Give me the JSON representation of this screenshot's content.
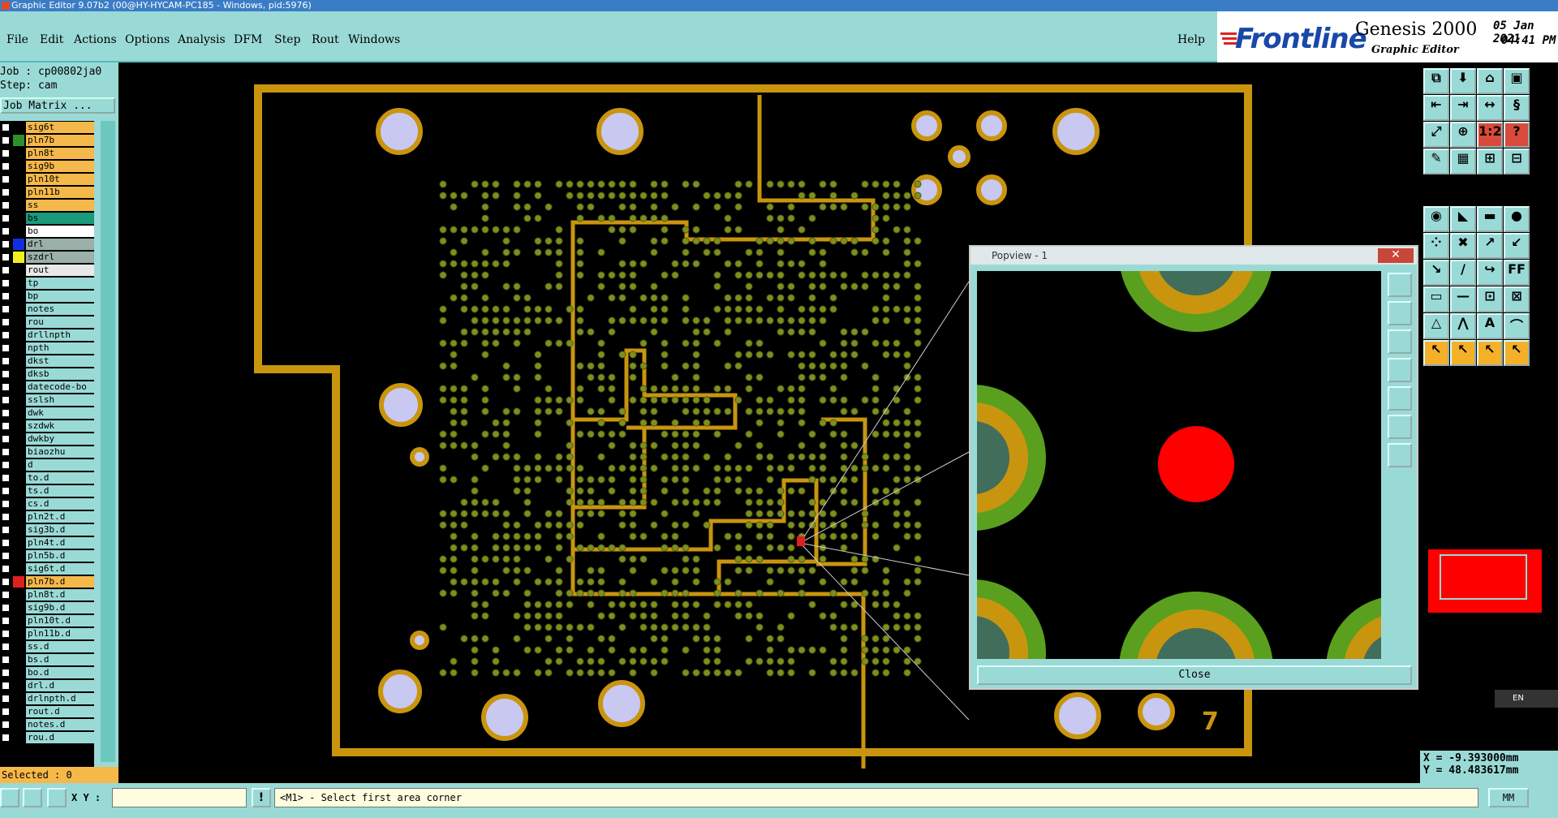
{
  "window": {
    "title": "Graphic Editor 9.07b2 (00@HY-HYCAM-PC185 - Windows, pid:5976)"
  },
  "menubar": {
    "items": [
      {
        "label": "File"
      },
      {
        "label": "Edit"
      },
      {
        "label": "Actions"
      },
      {
        "label": "Options"
      },
      {
        "label": "Analysis"
      },
      {
        "label": "DFM"
      },
      {
        "label": "Step"
      },
      {
        "label": "Rout"
      },
      {
        "label": "Windows"
      }
    ],
    "help": "Help"
  },
  "branding": {
    "logo": "Frontline",
    "product": "Genesis 2000",
    "subtitle": "Graphic Editor",
    "date": "05 Jan 2021",
    "time": "04:41 PM"
  },
  "job": {
    "job_label": "Job : cp00802ja0",
    "step_label": "Step: cam",
    "job_matrix": "Job Matrix ..."
  },
  "layers": [
    {
      "name": "sig6t",
      "color": "#f5b84a",
      "swatch": "#000"
    },
    {
      "name": "pln7b",
      "color": "#f5b84a",
      "swatch": "#2f8f2f"
    },
    {
      "name": "pln8t",
      "color": "#f5b84a",
      "swatch": "#000"
    },
    {
      "name": "sig9b",
      "color": "#f5b84a",
      "swatch": "#000"
    },
    {
      "name": "pln10t",
      "color": "#f5b84a",
      "swatch": "#000"
    },
    {
      "name": "pln11b",
      "color": "#f5b84a",
      "swatch": "#000"
    },
    {
      "name": "ss",
      "color": "#f5b84a",
      "swatch": "#000"
    },
    {
      "name": "bs",
      "color": "#1a9a7a",
      "swatch": "#000"
    },
    {
      "name": "bo",
      "color": "#ffffff",
      "swatch": "#000"
    },
    {
      "name": "drl",
      "color": "#9ab0a8",
      "swatch": "#1030e0"
    },
    {
      "name": "szdrl",
      "color": "#9ab0a8",
      "swatch": "#f0f020"
    },
    {
      "name": "rout",
      "color": "#e8e8e8",
      "swatch": "#000"
    },
    {
      "name": "tp",
      "color": "#9adad6",
      "swatch": "#000"
    },
    {
      "name": "bp",
      "color": "#9adad6",
      "swatch": "#000"
    },
    {
      "name": "notes",
      "color": "#9adad6",
      "swatch": "#000"
    },
    {
      "name": "rou",
      "color": "#9adad6",
      "swatch": "#000"
    },
    {
      "name": "drllnpth",
      "color": "#9adad6",
      "swatch": "#000"
    },
    {
      "name": "npth",
      "color": "#9adad6",
      "swatch": "#000"
    },
    {
      "name": "dkst",
      "color": "#9adad6",
      "swatch": "#000"
    },
    {
      "name": "dksb",
      "color": "#9adad6",
      "swatch": "#000"
    },
    {
      "name": "datecode-bo",
      "color": "#9adad6",
      "swatch": "#000"
    },
    {
      "name": "sslsh",
      "color": "#9adad6",
      "swatch": "#000"
    },
    {
      "name": "dwk",
      "color": "#9adad6",
      "swatch": "#000"
    },
    {
      "name": "szdwk",
      "color": "#9adad6",
      "swatch": "#000"
    },
    {
      "name": "dwkby",
      "color": "#9adad6",
      "swatch": "#000"
    },
    {
      "name": "biaozhu",
      "color": "#9adad6",
      "swatch": "#000"
    },
    {
      "name": "d",
      "color": "#9adad6",
      "swatch": "#000"
    },
    {
      "name": "to.d",
      "color": "#9adad6",
      "swatch": "#000"
    },
    {
      "name": "ts.d",
      "color": "#9adad6",
      "swatch": "#000"
    },
    {
      "name": "cs.d",
      "color": "#9adad6",
      "swatch": "#000"
    },
    {
      "name": "pln2t.d",
      "color": "#9adad6",
      "swatch": "#000"
    },
    {
      "name": "sig3b.d",
      "color": "#9adad6",
      "swatch": "#000"
    },
    {
      "name": "pln4t.d",
      "color": "#9adad6",
      "swatch": "#000"
    },
    {
      "name": "pln5b.d",
      "color": "#9adad6",
      "swatch": "#000"
    },
    {
      "name": "sig6t.d",
      "color": "#9adad6",
      "swatch": "#000"
    },
    {
      "name": "pln7b.d",
      "color": "#f5b84a",
      "swatch": "#e02020"
    },
    {
      "name": "pln8t.d",
      "color": "#9adad6",
      "swatch": "#000"
    },
    {
      "name": "sig9b.d",
      "color": "#9adad6",
      "swatch": "#000"
    },
    {
      "name": "pln10t.d",
      "color": "#9adad6",
      "swatch": "#000"
    },
    {
      "name": "pln11b.d",
      "color": "#9adad6",
      "swatch": "#000"
    },
    {
      "name": "ss.d",
      "color": "#9adad6",
      "swatch": "#000"
    },
    {
      "name": "bs.d",
      "color": "#9adad6",
      "swatch": "#000"
    },
    {
      "name": "bo.d",
      "color": "#9adad6",
      "swatch": "#000"
    },
    {
      "name": "drl.d",
      "color": "#9adad6",
      "swatch": "#000"
    },
    {
      "name": "drlnpth.d",
      "color": "#9adad6",
      "swatch": "#000"
    },
    {
      "name": "rout.d",
      "color": "#9adad6",
      "swatch": "#000"
    },
    {
      "name": "notes.d",
      "color": "#9adad6",
      "swatch": "#000"
    },
    {
      "name": "rou.d",
      "color": "#9adad6",
      "swatch": "#000"
    }
  ],
  "selected_label": "Selected : 0",
  "popview": {
    "title": "Popview - 1",
    "close": "Close"
  },
  "coords": {
    "x": "X = -9.393000mm",
    "y": "Y = 48.483617mm"
  },
  "bottom": {
    "xy_label": "X Y :",
    "xy_value": "",
    "message": "<M1> - Select first area corner",
    "units": "MM"
  },
  "board": {
    "corner_number": "7"
  },
  "colors": {
    "outline": "#c9950f",
    "pad": "#c8c8f0",
    "via": "#7f8f1f",
    "highlight": "#ff0000",
    "panel": "#9adad6"
  }
}
